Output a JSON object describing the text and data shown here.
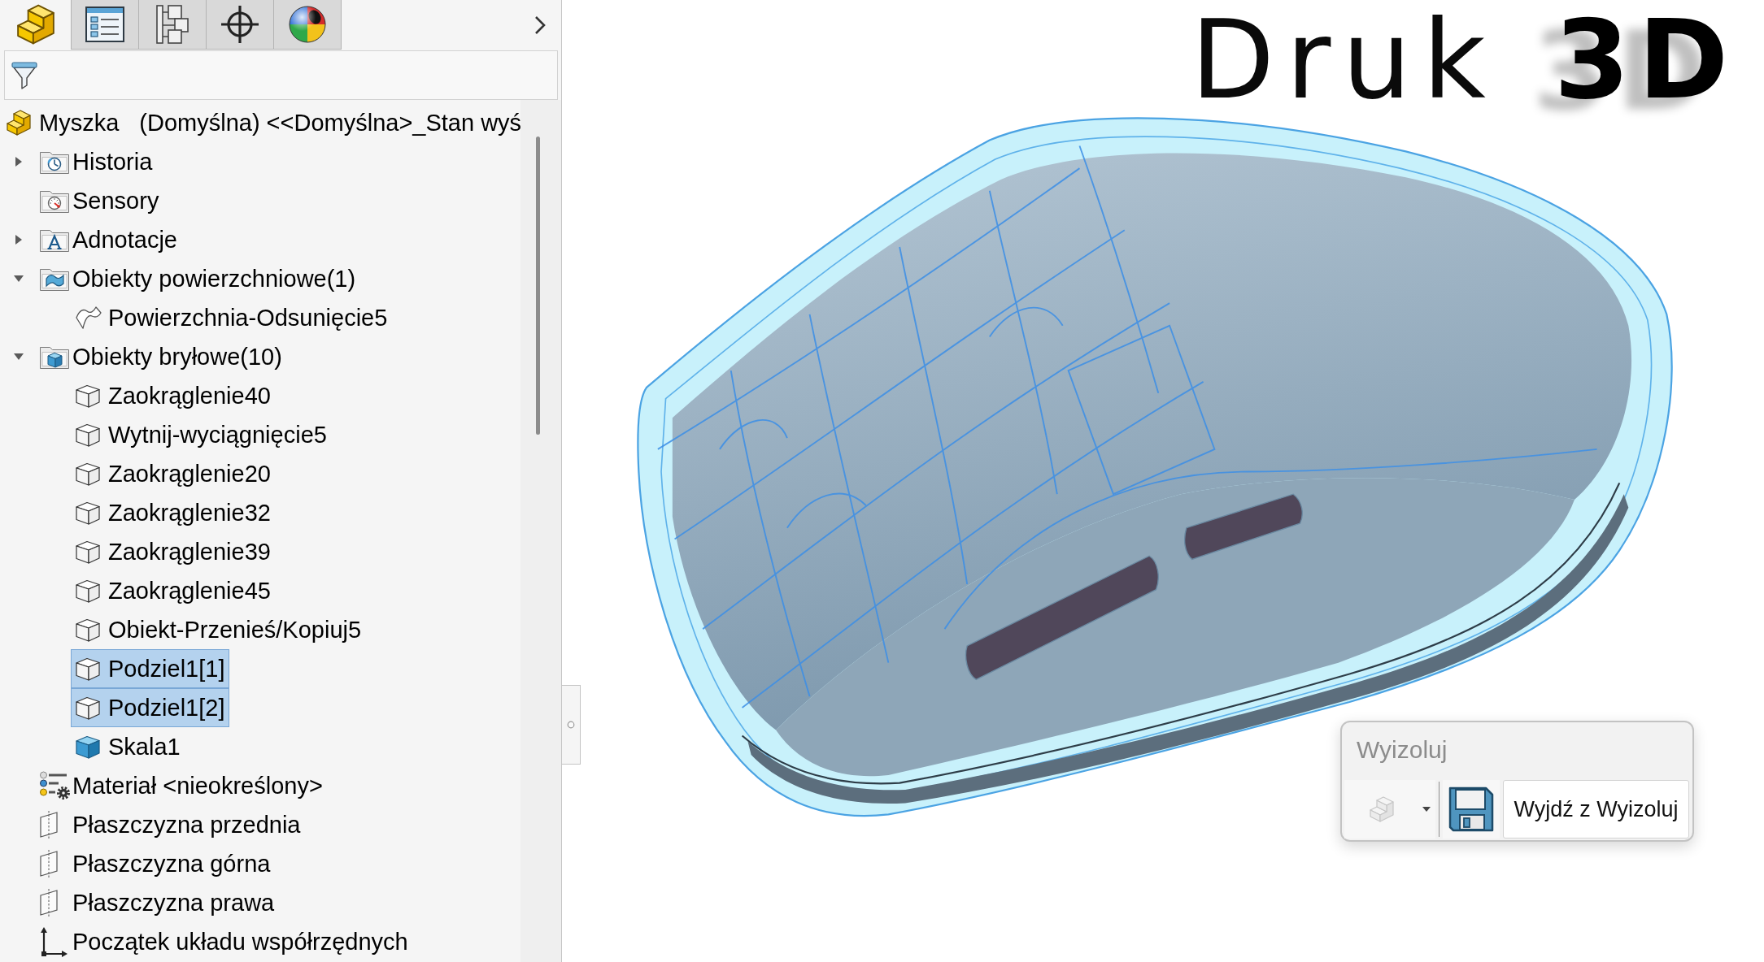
{
  "panel": {
    "tabs": [
      {
        "kind": "part",
        "selected": true
      },
      {
        "kind": "list",
        "selected": false
      },
      {
        "kind": "hierarchy",
        "selected": false
      },
      {
        "kind": "crosshair",
        "selected": false
      },
      {
        "kind": "appearance",
        "selected": false
      }
    ]
  },
  "tree": {
    "root": {
      "name": "Myszka",
      "configuration": "(Domyślna) <<Domyślna>_Stan wyś",
      "selected": false
    },
    "items": [
      {
        "label": "Historia",
        "kind": "history-folder",
        "expanded": false,
        "selected": false
      },
      {
        "label": "Sensory",
        "kind": "sensor-folder",
        "selected": false
      },
      {
        "label": "Adnotacje",
        "kind": "annotation-folder",
        "expanded": false,
        "selected": false
      },
      {
        "label": "Obiekty powierzchniowe(1)",
        "kind": "surface-folder",
        "expanded": true,
        "selected": false,
        "children": [
          {
            "label": "Powierzchnia-Odsunięcie5",
            "kind": "surface",
            "selected": false
          }
        ]
      },
      {
        "label": "Obiekty bryłowe(10)",
        "kind": "solid-folder",
        "expanded": true,
        "selected": false,
        "children": [
          {
            "label": "Zaokrąglenie40",
            "kind": "solid",
            "selected": false
          },
          {
            "label": "Wytnij-wyciągnięcie5",
            "kind": "solid",
            "selected": false
          },
          {
            "label": "Zaokrąglenie20",
            "kind": "solid",
            "selected": false
          },
          {
            "label": "Zaokrąglenie32",
            "kind": "solid",
            "selected": false
          },
          {
            "label": "Zaokrąglenie39",
            "kind": "solid",
            "selected": false
          },
          {
            "label": "Zaokrąglenie45",
            "kind": "solid",
            "selected": false
          },
          {
            "label": "Obiekt-Przenieś/Kopiuj5",
            "kind": "solid",
            "selected": false
          },
          {
            "label": "Podziel1[1]",
            "kind": "solid",
            "selected": true
          },
          {
            "label": "Podziel1[2]",
            "kind": "solid",
            "selected": true
          },
          {
            "label": "Skala1",
            "kind": "solid-shaded",
            "selected": false
          }
        ]
      },
      {
        "label": "Materiał <nieokreślony>",
        "kind": "material",
        "selected": false
      },
      {
        "label": "Płaszczyzna przednia",
        "kind": "plane",
        "selected": false
      },
      {
        "label": "Płaszczyzna górna",
        "kind": "plane",
        "selected": false
      },
      {
        "label": "Płaszczyzna prawa",
        "kind": "plane",
        "selected": false
      },
      {
        "label": "Początek układu współrzędnych",
        "kind": "origin",
        "selected": false
      }
    ]
  },
  "viewport": {
    "logo": {
      "text": "Druk",
      "emphasis": "3D"
    },
    "isolate_toolbar": {
      "title": "Wyizoluj",
      "buttons": [
        {
          "kind": "display-style",
          "disabled": true
        },
        {
          "kind": "save",
          "disabled": false
        },
        {
          "kind": "exit",
          "label": "Wyjdź z Wyizoluj",
          "disabled": false
        }
      ]
    }
  }
}
